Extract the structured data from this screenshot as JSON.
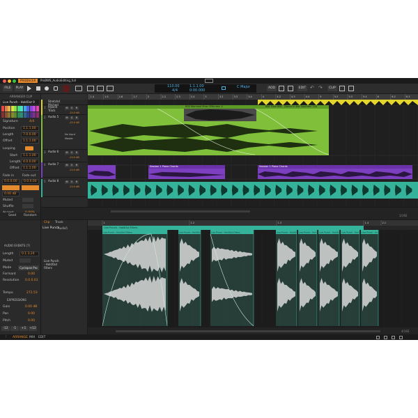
{
  "titlebar": {
    "profile": "PRODUCER",
    "project_tab": "ProBWS_AudioEditing_full",
    "logo": "bitwig-logo"
  },
  "toolbar": {
    "file": "FILE",
    "play_label": "PLAY",
    "tempo": "110.00",
    "time_sig": "4/4",
    "position": "1.1.1.00",
    "time": "0:00.000",
    "key": "C Major",
    "add": "ADD",
    "edit": "EDIT",
    "clip": "CLIP"
  },
  "ruler": {
    "ticks": [
      "1.4",
      "1.5",
      "1.6",
      "1.7",
      "2",
      "2.2",
      "2.3",
      "2.4",
      "3",
      "3.2",
      "3.3",
      "3.4",
      "4",
      "4.2",
      "4.3",
      "4.4",
      "5",
      "5.2",
      "5.3",
      "5.4",
      "6",
      "6.2",
      "6.3"
    ]
  },
  "inspector": {
    "header": "ARRANGER CLIP",
    "clip_name": "Live Punch - HoldOut 9",
    "signature_label": "Signature",
    "signature_value": "4/4",
    "position_label": "Position",
    "position_value": "1.1.1.00",
    "length_label": "Length",
    "length_value": "7.0.0.00",
    "offset_label": "Offset",
    "offset_value": "1.1.1.00",
    "looping_label": "Looping",
    "start_label": "Start",
    "start_value": "1.1.1.00",
    "loop_length_label": "Length",
    "loop_length_value": "4.0.0.00",
    "loop_offset_label": "Offset",
    "loop_offset_value": "1.1.1.00",
    "fade_in_label": "Fade in",
    "fade_out_label": "Fade out",
    "fade_in_value": "0.0.0.00",
    "fade_out_value": "0.0.0.00",
    "gain_value": "0.00 dB",
    "muted_label": "Muted",
    "shuffle_label": "Shuffle",
    "accent_label": "Accent",
    "accent_value": "0.00%",
    "seed_label": "Seed",
    "random_label": "Random"
  },
  "tracks": [
    {
      "name": "Stretchd Pitched",
      "number": ""
    },
    {
      "name": "Hybrid Track",
      "number": "1"
    },
    {
      "name": "Audio 5",
      "number": "2"
    },
    {
      "name": "Audio 6",
      "number": "3"
    },
    {
      "name": "Audio 7",
      "number": "4"
    },
    {
      "name": "Audio 8",
      "number": "5"
    }
  ],
  "track_controls": {
    "volume": "-10.0 dB",
    "input": "No Input",
    "output": "Master"
  },
  "clips": {
    "green_a": "808 Warmest Mew Offscreen 4",
    "green_b": "808 Slow 808 - Dance in the Southern 144",
    "purple": "Session 1 Piano Chords",
    "purple_b": "Session 1 Piano Chords"
  },
  "arranger_footer": {
    "page": "1/192"
  },
  "editor": {
    "tab_clip": "Clip",
    "tab_track": "Track",
    "clip_title": "Live Punch",
    "track_label": "Audio5",
    "section_audio_events": "AUDIO EVENTS (7)",
    "length_label": "Length",
    "length_value": "0.1.3.24",
    "muted_label": "Muted",
    "mode_label": "Mode",
    "mode_value": "Cyclopse Pro",
    "formant_label": "Formant",
    "formant_value": "0.00",
    "resolution_label": "Resolution",
    "resolution_value": "0.0.0.01",
    "tempo_label": "Tempo",
    "tempo_value": "272.53",
    "section_expressions": "EXPRESSIONS",
    "gain_label": "Gain",
    "gain_value": "0.00 dB",
    "pan_label": "Pan",
    "pan_value": "0.00",
    "pitch_label": "Pitch",
    "pitch_value": "0.00",
    "pitch_buttons": [
      "-12",
      "-1",
      "+1",
      "+12"
    ],
    "side_caption": "Live Punch - HoldOut Filters",
    "ruler_ticks": [
      "1",
      "1.2",
      "1.3",
      "1.4",
      "2.1"
    ],
    "main_clip_label": "Live Punch - HoldOut Filters",
    "events": [
      "Live Punch - HoldOut Filters",
      "Live Punch - HoldOut",
      "Live Punch - HoldOut Filters",
      "Live Punch - HoldOut",
      "Live Punch - HoldOut",
      "Live Punch - HoldOut",
      "Live Punch - HoldOut",
      "Live Punch - HoldOut"
    ],
    "footer_page": "4/192"
  },
  "statusbar": {
    "arrange": "ARRANGE",
    "mix": "MIX",
    "edit": "EDIT"
  },
  "colors": {
    "accent": "#e58a2d",
    "green_clip": "#7fbf3a",
    "purple_clip": "#7c3fbf",
    "teal_clip": "#35b39a",
    "yellow_clip": "#e3d52c"
  }
}
